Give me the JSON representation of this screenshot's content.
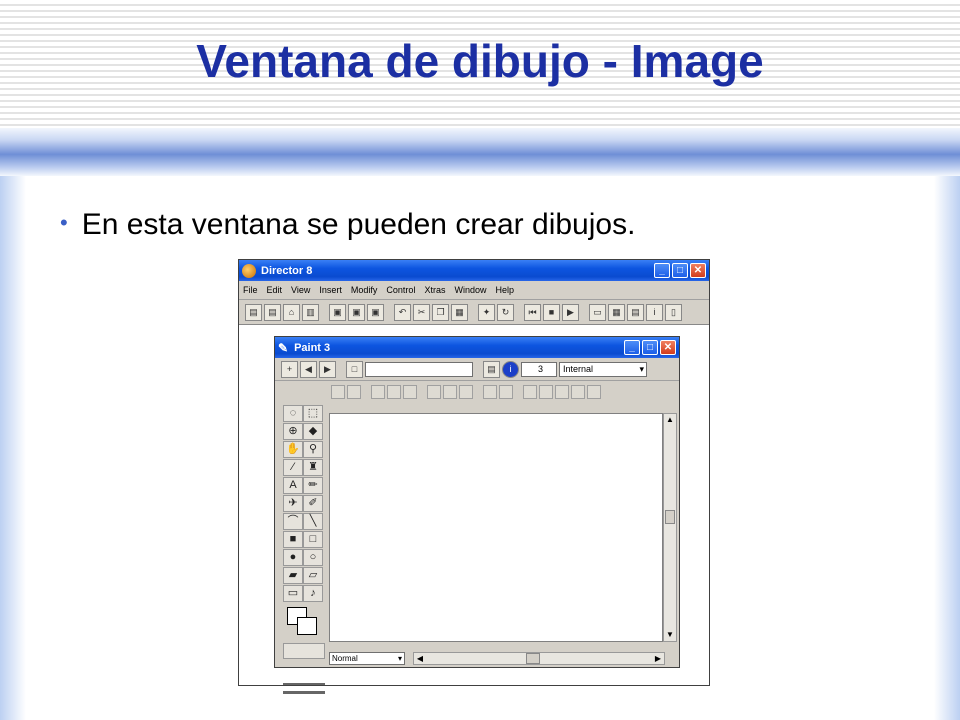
{
  "slide": {
    "title": "Ventana de dibujo - Image",
    "bullet": "En esta ventana se pueden crear dibujos."
  },
  "director": {
    "title": "Director 8",
    "menu": [
      "File",
      "Edit",
      "View",
      "Insert",
      "Modify",
      "Control",
      "Xtras",
      "Window",
      "Help"
    ]
  },
  "paint": {
    "title": "Paint 3",
    "cast_number": "3",
    "cast_library": "Internal",
    "ink": "Normal"
  },
  "icons": {
    "minimize": "minimize-icon",
    "maximize": "maximize-icon",
    "close": "close-icon"
  },
  "colors": {
    "title_text": "#1c2fa3",
    "xp_titlebar": "#0a4bd0"
  }
}
